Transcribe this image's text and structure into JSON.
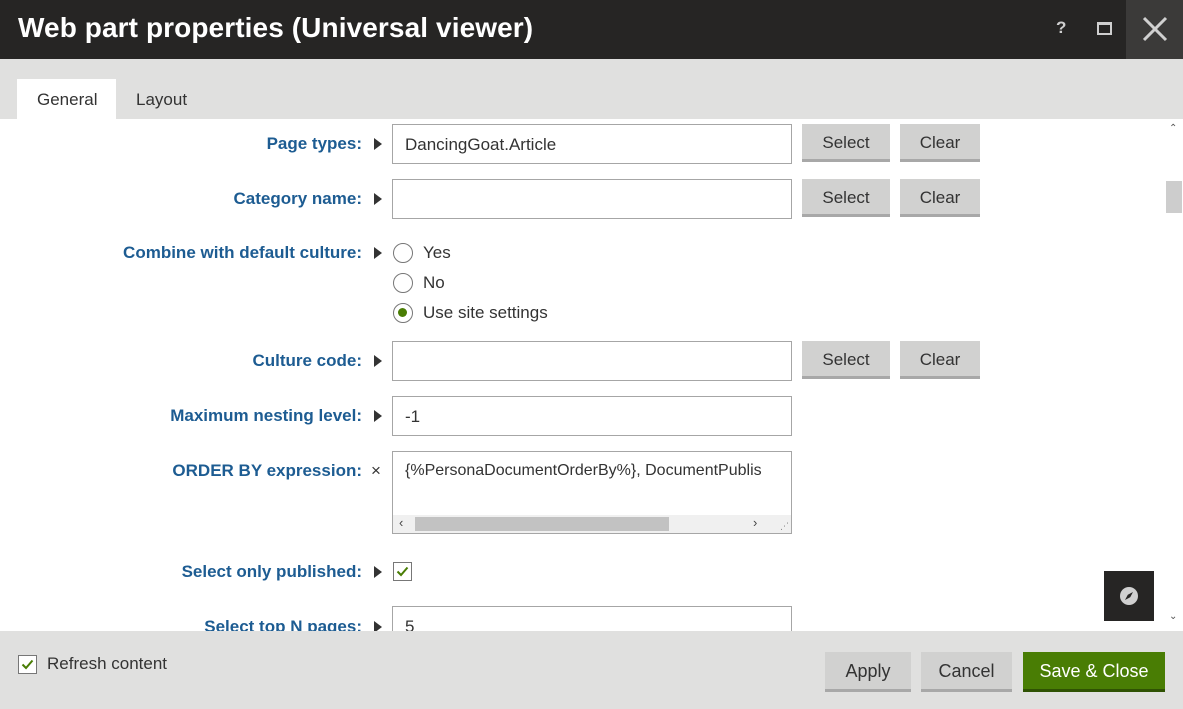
{
  "window": {
    "title": "Web part properties (Universal viewer)",
    "help_label": "?",
    "icons": {
      "help": "help-icon",
      "maximize": "maximize-icon",
      "close": "close-icon"
    }
  },
  "tabs": [
    {
      "label": "General",
      "active": true
    },
    {
      "label": "Layout",
      "active": false
    }
  ],
  "form": {
    "page_types": {
      "label": "Page types:",
      "value": "DancingGoat.Article",
      "select_label": "Select",
      "clear_label": "Clear"
    },
    "category_name": {
      "label": "Category name:",
      "value": "",
      "select_label": "Select",
      "clear_label": "Clear"
    },
    "combine_culture": {
      "label": "Combine with default culture:",
      "options": [
        {
          "label": "Yes",
          "checked": false
        },
        {
          "label": "No",
          "checked": false
        },
        {
          "label": "Use site settings",
          "checked": true
        }
      ]
    },
    "culture_code": {
      "label": "Culture code:",
      "value": "",
      "select_label": "Select",
      "clear_label": "Clear"
    },
    "max_nesting": {
      "label": "Maximum nesting level:",
      "value": "-1"
    },
    "order_by": {
      "label": "ORDER BY expression:",
      "value": "{%PersonaDocumentOrderBy%}, DocumentPublis",
      "marker": "×"
    },
    "select_published": {
      "label": "Select only published:",
      "checked": true
    },
    "top_n": {
      "label": "Select top N pages:",
      "value": "5"
    }
  },
  "footer": {
    "refresh_content": {
      "label": "Refresh content",
      "checked": true
    },
    "apply_label": "Apply",
    "cancel_label": "Cancel",
    "save_close_label": "Save & Close"
  },
  "colors": {
    "title_bar": "#262524",
    "label_blue": "#1d5c92",
    "accent_green": "#497d04",
    "button_gray": "#d1d1d0"
  }
}
